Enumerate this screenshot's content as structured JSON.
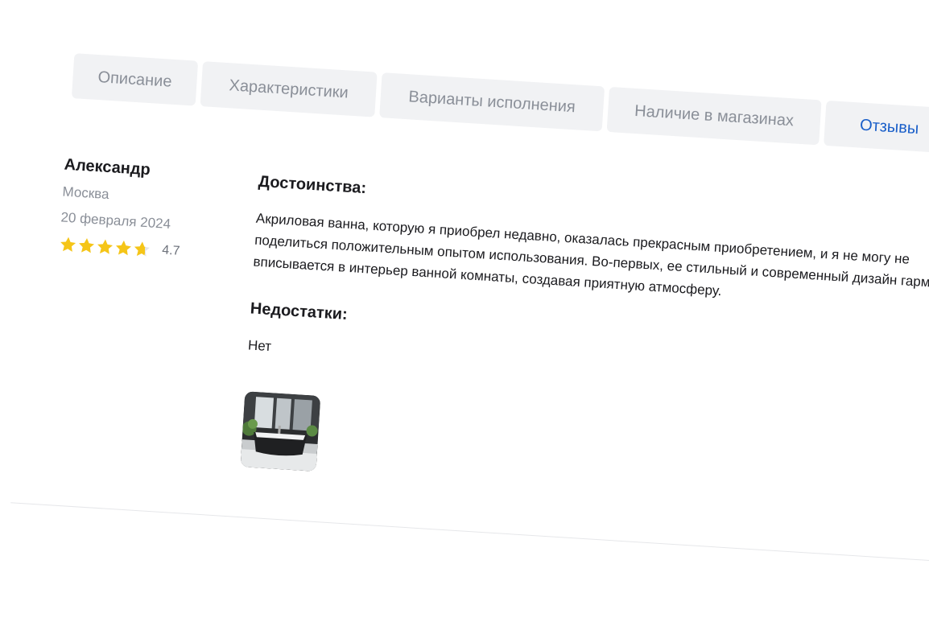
{
  "tabs": [
    {
      "label": "Описание",
      "active": false
    },
    {
      "label": "Характеристики",
      "active": false
    },
    {
      "label": "Варианты исполнения",
      "active": false
    },
    {
      "label": "Наличие в магазинах",
      "active": false
    },
    {
      "label": "Отзывы",
      "active": true
    }
  ],
  "reviewer": {
    "name": "Александр",
    "city": "Москва",
    "date": "20 февраля 2024",
    "rating_value": "4.7",
    "rating": 4.7,
    "rating_max": 5
  },
  "review": {
    "pros_title": "Достоинства:",
    "pros_text": "Акриловая ванна, которую я приобрел недавно, оказалась прекрасным приобретением, и я не могу не поделиться положительным опытом использования. Во-первых, ее стильный и современный дизайн гармонично вписывается в интерьер ванной комнаты, создавая приятную атмосферу.",
    "cons_title": "Недостатки:",
    "cons_text": "Нет"
  },
  "colors": {
    "accent": "#1a5fc9",
    "star": "#f5c518",
    "star_empty": "#e4e5e8",
    "tab_bg": "#f1f2f4",
    "muted": "#8a8f98"
  },
  "icons": {
    "star": "star-icon"
  }
}
